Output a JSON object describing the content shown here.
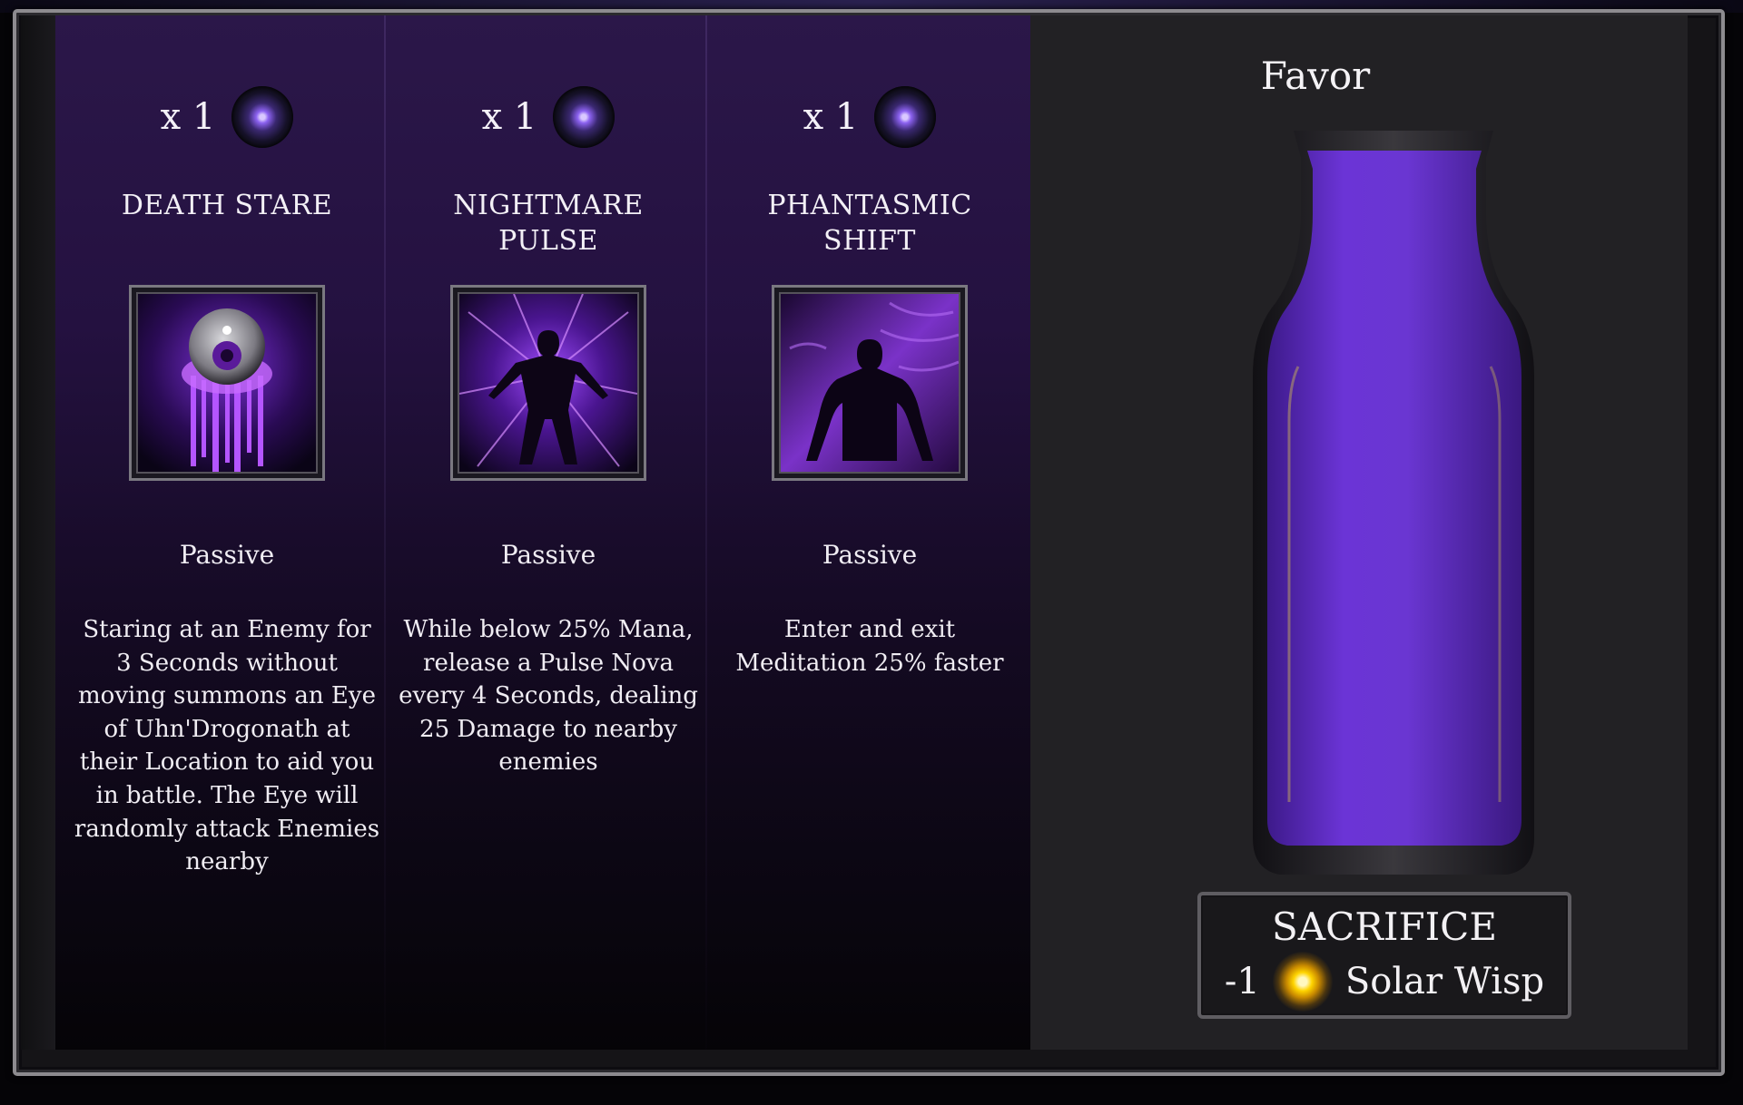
{
  "abilities": [
    {
      "count": "x 1",
      "name": "DEATH STARE",
      "type": "Passive",
      "description": "Staring at an Enemy for 3 Seconds without moving summons an Eye of Uhn'Drogonath at their Location to aid you in battle. The Eye will randomly attack Enemies nearby",
      "icon": "death-stare-icon"
    },
    {
      "count": "x 1",
      "name": "NIGHTMARE\nPULSE",
      "type": "Passive",
      "description": "While below 25% Mana, release a Pulse Nova every 4 Seconds, dealing 25 Damage to nearby enemies",
      "icon": "nightmare-pulse-icon"
    },
    {
      "count": "x 1",
      "name": "PHANTASMIC\nSHIFT",
      "type": "Passive",
      "description": "Enter and exit Meditation 25% faster",
      "icon": "phantasmic-shift-icon"
    }
  ],
  "favor": {
    "title": "Favor",
    "fill_fraction": 1.0,
    "color": "#5b27c8"
  },
  "sacrifice": {
    "title": "SACRIFICE",
    "amount": "-1",
    "item": "Solar Wisp",
    "icon": "solar-wisp-icon"
  },
  "colors": {
    "accent": "#7a3cff",
    "panel_dark": "#222124"
  }
}
